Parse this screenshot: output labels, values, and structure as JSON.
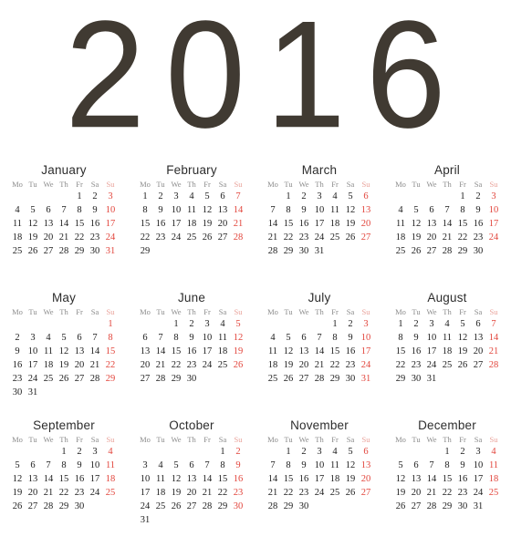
{
  "page": {
    "type": "year-calendar",
    "year_label": "2016",
    "background_color": "#ffffff",
    "year_color": "#403a32",
    "weekday_color": "#8c8c8c",
    "sunday_header_color": "#e9a29a",
    "date_color": "#1c1c1c",
    "sunday_date_color": "#e2453c",
    "month_title_color": "#2d2d2d",
    "week_start": "Monday"
  },
  "weekdays": [
    "Mo",
    "Tu",
    "We",
    "Th",
    "Fr",
    "Sa",
    "Su"
  ],
  "months": [
    {
      "name": "January",
      "days_in_month": 31,
      "start_weekday_index": 4,
      "weeks": [
        [
          "",
          "",
          "",
          "",
          "1",
          "2",
          "3"
        ],
        [
          "4",
          "5",
          "6",
          "7",
          "8",
          "9",
          "10"
        ],
        [
          "11",
          "12",
          "13",
          "14",
          "15",
          "16",
          "17"
        ],
        [
          "18",
          "19",
          "20",
          "21",
          "22",
          "23",
          "24"
        ],
        [
          "25",
          "26",
          "27",
          "28",
          "29",
          "30",
          "31"
        ]
      ]
    },
    {
      "name": "February",
      "days_in_month": 29,
      "start_weekday_index": 0,
      "weeks": [
        [
          "1",
          "2",
          "3",
          "4",
          "5",
          "6",
          "7"
        ],
        [
          "8",
          "9",
          "10",
          "11",
          "12",
          "13",
          "14"
        ],
        [
          "15",
          "16",
          "17",
          "18",
          "19",
          "20",
          "21"
        ],
        [
          "22",
          "23",
          "24",
          "25",
          "26",
          "27",
          "28"
        ],
        [
          "29",
          "",
          "",
          "",
          "",
          "",
          ""
        ]
      ]
    },
    {
      "name": "March",
      "days_in_month": 31,
      "start_weekday_index": 1,
      "weeks": [
        [
          "",
          "1",
          "2",
          "3",
          "4",
          "5",
          "6"
        ],
        [
          "7",
          "8",
          "9",
          "10",
          "11",
          "12",
          "13"
        ],
        [
          "14",
          "15",
          "16",
          "17",
          "18",
          "19",
          "20"
        ],
        [
          "21",
          "22",
          "23",
          "24",
          "25",
          "26",
          "27"
        ],
        [
          "28",
          "29",
          "30",
          "31",
          "",
          "",
          ""
        ]
      ]
    },
    {
      "name": "April",
      "days_in_month": 30,
      "start_weekday_index": 4,
      "weeks": [
        [
          "",
          "",
          "",
          "",
          "1",
          "2",
          "3"
        ],
        [
          "4",
          "5",
          "6",
          "7",
          "8",
          "9",
          "10"
        ],
        [
          "11",
          "12",
          "13",
          "14",
          "15",
          "16",
          "17"
        ],
        [
          "18",
          "19",
          "20",
          "21",
          "22",
          "23",
          "24"
        ],
        [
          "25",
          "26",
          "27",
          "28",
          "29",
          "30",
          ""
        ]
      ]
    },
    {
      "name": "May",
      "days_in_month": 31,
      "start_weekday_index": 6,
      "weeks": [
        [
          "",
          "",
          "",
          "",
          "",
          "",
          "1"
        ],
        [
          "2",
          "3",
          "4",
          "5",
          "6",
          "7",
          "8"
        ],
        [
          "9",
          "10",
          "11",
          "12",
          "13",
          "14",
          "15"
        ],
        [
          "16",
          "17",
          "18",
          "19",
          "20",
          "21",
          "22"
        ],
        [
          "23",
          "24",
          "25",
          "26",
          "27",
          "28",
          "29"
        ],
        [
          "30",
          "31",
          "",
          "",
          "",
          "",
          ""
        ]
      ]
    },
    {
      "name": "June",
      "days_in_month": 30,
      "start_weekday_index": 2,
      "weeks": [
        [
          "",
          "",
          "1",
          "2",
          "3",
          "4",
          "5"
        ],
        [
          "6",
          "7",
          "8",
          "9",
          "10",
          "11",
          "12"
        ],
        [
          "13",
          "14",
          "15",
          "16",
          "17",
          "18",
          "19"
        ],
        [
          "20",
          "21",
          "22",
          "23",
          "24",
          "25",
          "26"
        ],
        [
          "27",
          "28",
          "29",
          "30",
          "",
          "",
          ""
        ]
      ]
    },
    {
      "name": "July",
      "days_in_month": 31,
      "start_weekday_index": 4,
      "weeks": [
        [
          "",
          "",
          "",
          "",
          "1",
          "2",
          "3"
        ],
        [
          "4",
          "5",
          "6",
          "7",
          "8",
          "9",
          "10"
        ],
        [
          "11",
          "12",
          "13",
          "14",
          "15",
          "16",
          "17"
        ],
        [
          "18",
          "19",
          "20",
          "21",
          "22",
          "23",
          "24"
        ],
        [
          "25",
          "26",
          "27",
          "28",
          "29",
          "30",
          "31"
        ]
      ]
    },
    {
      "name": "August",
      "days_in_month": 31,
      "start_weekday_index": 0,
      "weeks": [
        [
          "1",
          "2",
          "3",
          "4",
          "5",
          "6",
          "7"
        ],
        [
          "8",
          "9",
          "10",
          "11",
          "12",
          "13",
          "14"
        ],
        [
          "15",
          "16",
          "17",
          "18",
          "19",
          "20",
          "21"
        ],
        [
          "22",
          "23",
          "24",
          "25",
          "26",
          "27",
          "28"
        ],
        [
          "29",
          "30",
          "31",
          "",
          "",
          "",
          ""
        ]
      ]
    },
    {
      "name": "September",
      "days_in_month": 30,
      "start_weekday_index": 3,
      "weeks": [
        [
          "",
          "",
          "",
          "1",
          "2",
          "3",
          "4"
        ],
        [
          "5",
          "6",
          "7",
          "8",
          "9",
          "10",
          "11"
        ],
        [
          "12",
          "13",
          "14",
          "15",
          "16",
          "17",
          "18"
        ],
        [
          "19",
          "20",
          "21",
          "22",
          "23",
          "24",
          "25"
        ],
        [
          "26",
          "27",
          "28",
          "29",
          "30",
          "",
          ""
        ]
      ]
    },
    {
      "name": "October",
      "days_in_month": 31,
      "start_weekday_index": 5,
      "weeks": [
        [
          "",
          "",
          "",
          "",
          "",
          "1",
          "2"
        ],
        [
          "3",
          "4",
          "5",
          "6",
          "7",
          "8",
          "9"
        ],
        [
          "10",
          "11",
          "12",
          "13",
          "14",
          "15",
          "16"
        ],
        [
          "17",
          "18",
          "19",
          "20",
          "21",
          "22",
          "23"
        ],
        [
          "24",
          "25",
          "26",
          "27",
          "28",
          "29",
          "30"
        ],
        [
          "31",
          "",
          "",
          "",
          "",
          "",
          ""
        ]
      ]
    },
    {
      "name": "November",
      "days_in_month": 30,
      "start_weekday_index": 1,
      "weeks": [
        [
          "",
          "1",
          "2",
          "3",
          "4",
          "5",
          "6"
        ],
        [
          "7",
          "8",
          "9",
          "10",
          "11",
          "12",
          "13"
        ],
        [
          "14",
          "15",
          "16",
          "17",
          "18",
          "19",
          "20"
        ],
        [
          "21",
          "22",
          "23",
          "24",
          "25",
          "26",
          "27"
        ],
        [
          "28",
          "29",
          "30",
          "",
          "",
          "",
          ""
        ]
      ]
    },
    {
      "name": "December",
      "days_in_month": 31,
      "start_weekday_index": 3,
      "weeks": [
        [
          "",
          "",
          "",
          "1",
          "2",
          "3",
          "4"
        ],
        [
          "5",
          "6",
          "7",
          "8",
          "9",
          "10",
          "11"
        ],
        [
          "12",
          "13",
          "14",
          "15",
          "16",
          "17",
          "18"
        ],
        [
          "19",
          "20",
          "21",
          "22",
          "23",
          "24",
          "25"
        ],
        [
          "26",
          "27",
          "28",
          "29",
          "30",
          "31",
          ""
        ]
      ]
    }
  ]
}
